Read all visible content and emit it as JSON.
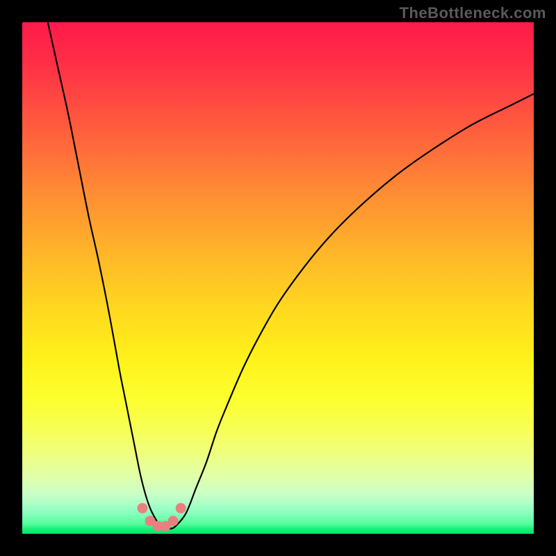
{
  "watermark": "TheBottleneck.com",
  "chart_data": {
    "type": "line",
    "title": "",
    "xlabel": "",
    "ylabel": "",
    "xlim": [
      0,
      100
    ],
    "ylim": [
      0,
      100
    ],
    "series": [
      {
        "name": "curve",
        "x": [
          5,
          7,
          9,
          11,
          13,
          15,
          17,
          19,
          20,
          21,
          22,
          23,
          24,
          25,
          26,
          27,
          28,
          29,
          30,
          32,
          34,
          36,
          38,
          40,
          43,
          46,
          50,
          55,
          60,
          66,
          73,
          80,
          88,
          96,
          100
        ],
        "y": [
          100,
          91,
          82,
          72,
          62,
          53,
          43,
          32,
          27,
          22,
          17,
          12,
          8,
          5,
          3,
          1.5,
          1,
          1,
          1.5,
          4,
          9,
          14,
          20,
          25,
          32,
          38,
          45,
          52,
          58,
          64,
          70,
          75,
          80,
          84,
          86
        ]
      },
      {
        "name": "minimum-markers",
        "x": [
          23.5,
          25,
          26.5,
          28,
          29.5,
          31
        ],
        "y": [
          5,
          2.5,
          1.5,
          1.5,
          2.5,
          5
        ]
      }
    ],
    "gradient_stops": [
      {
        "pos": 0,
        "color": "#ff1a4a"
      },
      {
        "pos": 33,
        "color": "#ff8b34"
      },
      {
        "pos": 66,
        "color": "#fff21a"
      },
      {
        "pos": 92,
        "color": "#ccffc6"
      },
      {
        "pos": 100,
        "color": "#00e765"
      }
    ]
  }
}
